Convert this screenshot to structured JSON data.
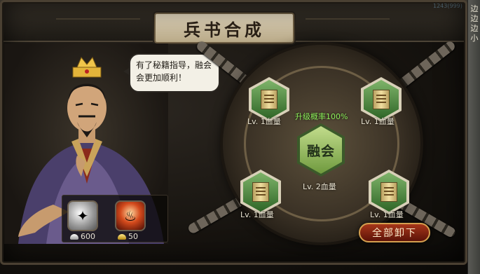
{
  "title": "兵书合成",
  "top_digits": "1243(999)",
  "map_labels": [
    "边",
    "边",
    "边",
    "小"
  ],
  "npc": {
    "dialog": "有了秘籍指导，融会会更加顺利！"
  },
  "items": [
    {
      "name": "silver-ingot",
      "icon": "silver-icon",
      "count": "600",
      "currency": "silver"
    },
    {
      "name": "red-totem",
      "icon": "fire-icon",
      "count": "50",
      "currency": "gold"
    }
  ],
  "synthesis": {
    "success_rate": "升级概率100%",
    "merge_label": "融会",
    "result_label": "Lv. 2血量",
    "slots": [
      {
        "label": "Lv. 1血量"
      },
      {
        "label": "Lv. 1血量"
      },
      {
        "label": "Lv. 1血量"
      },
      {
        "label": "Lv. 1血量"
      }
    ],
    "unload_all_label": "全部卸下"
  },
  "colors": {
    "accent_green": "#8cf05a",
    "button_red": "#a6361a",
    "slot_green": "#2f6627"
  }
}
